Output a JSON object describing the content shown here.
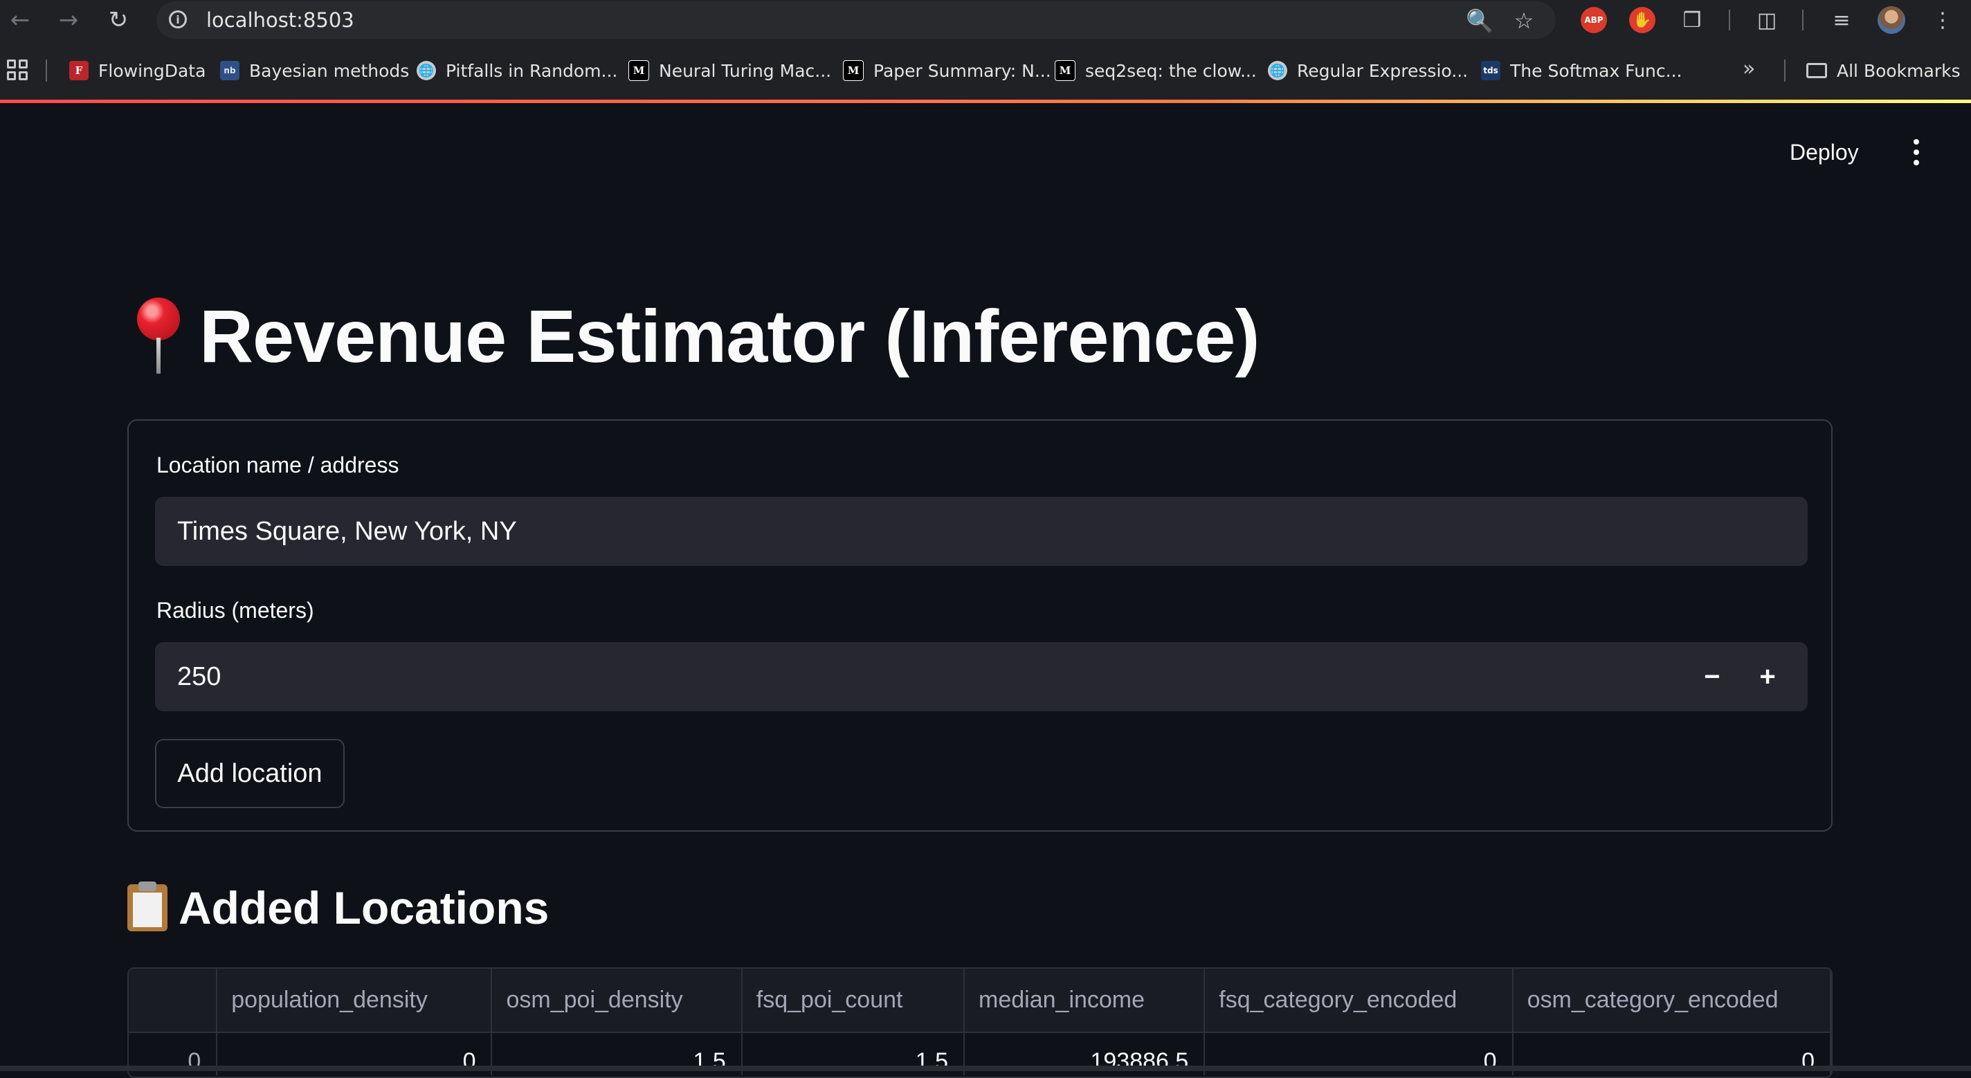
{
  "browser": {
    "url": "localhost:8503",
    "bookmarks": [
      {
        "label": "FlowingData",
        "icon": "flowingdata-favicon"
      },
      {
        "label": "Bayesian methods",
        "icon": "notebook-favicon"
      },
      {
        "label": "Pitfalls in Random...",
        "icon": "globe-icon"
      },
      {
        "label": "Neural Turing Mac...",
        "icon": "medium-favicon"
      },
      {
        "label": "Paper Summary: N...",
        "icon": "medium-favicon"
      },
      {
        "label": "seq2seq: the clow...",
        "icon": "medium-favicon"
      },
      {
        "label": "Regular Expressio...",
        "icon": "globe-icon"
      },
      {
        "label": "The Softmax Func...",
        "icon": "tds-favicon"
      }
    ],
    "all_bookmarks": "All Bookmarks",
    "abp_label": "ABP"
  },
  "header": {
    "deploy_label": "Deploy"
  },
  "main": {
    "title": "Revenue Estimator (Inference)",
    "form": {
      "location_label": "Location name / address",
      "location_value": "Times Square, New York, NY",
      "radius_label": "Radius (meters)",
      "radius_value": "250",
      "add_button": "Add location"
    },
    "added_title": "Added Locations",
    "table": {
      "columns": [
        "",
        "population_density",
        "osm_poi_density",
        "fsq_poi_count",
        "median_income",
        "fsq_category_encoded",
        "osm_category_encoded"
      ],
      "rows": [
        [
          "0",
          "0",
          "1.5",
          "1.5",
          "193886.5",
          "0",
          "0"
        ]
      ]
    }
  },
  "colors": {
    "background": "#0e1117",
    "input_background": "#262730",
    "accent_gradient_start": "#ff4b4b",
    "accent_gradient_end": "#fffd80"
  }
}
